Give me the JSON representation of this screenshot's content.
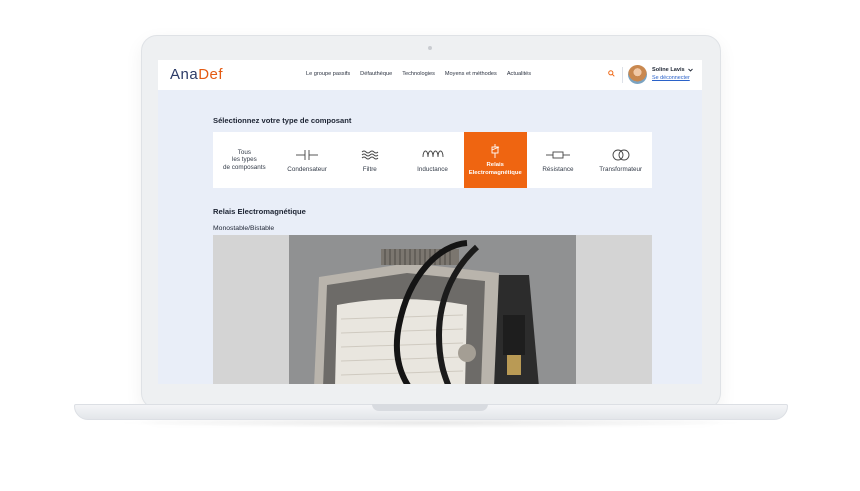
{
  "brand": {
    "name_part1": "Ana",
    "name_part2": "Def"
  },
  "nav": {
    "items": [
      {
        "label": "Le groupe passifs"
      },
      {
        "label": "Défauthèque"
      },
      {
        "label": "Technologies"
      },
      {
        "label": "Moyens et méthodes"
      },
      {
        "label": "Actualités"
      }
    ]
  },
  "user": {
    "name": "Soline Lavis",
    "logout_label": "Se déconnecter"
  },
  "selector": {
    "title": "Sélectionnez votre type de composant",
    "types": [
      {
        "label": "Tous\nles types\nde composants",
        "icon": "none"
      },
      {
        "label": "Condensateur",
        "icon": "capacitor-icon"
      },
      {
        "label": "Filtre",
        "icon": "filter-icon"
      },
      {
        "label": "Inductance",
        "icon": "inductor-icon"
      },
      {
        "label": "Relais\nElectromagnétique",
        "icon": "relay-icon",
        "active": true
      },
      {
        "label": "Résistance",
        "icon": "resistor-icon"
      },
      {
        "label": "Transformateur",
        "icon": "transformer-icon"
      }
    ]
  },
  "detail": {
    "title": "Relais Electromagnétique",
    "subtitle": "Monostable/Bistable"
  },
  "colors": {
    "accent": "#ef6511",
    "brand_dark": "#2b3a67",
    "screen_bg": "#e9eef8",
    "link": "#2a62c9"
  }
}
